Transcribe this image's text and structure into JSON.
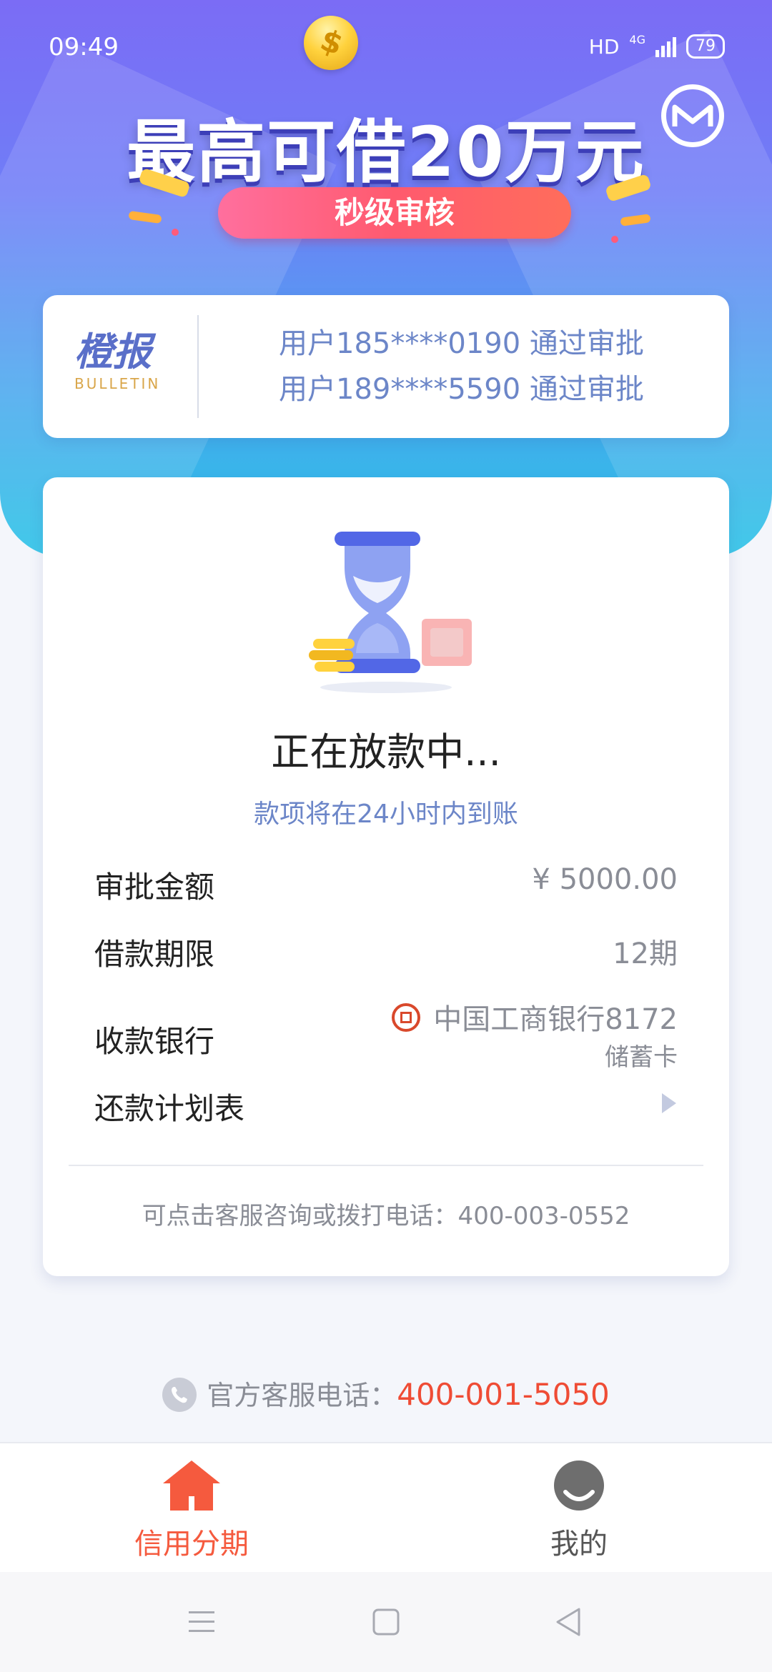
{
  "status_bar": {
    "time": "09:49",
    "hd": "HD",
    "net": "4G",
    "battery": "79"
  },
  "banner": {
    "headline": "最高可借20万元",
    "pill": "秒级审核"
  },
  "bulletin": {
    "logo_cn": "橙报",
    "logo_en": "BULLETIN",
    "messages": [
      "用户185****0190 通过审批",
      "用户189****5590 通过审批"
    ]
  },
  "loan_status": {
    "title": "正在放款中...",
    "subtitle": "款项将在24小时内到账",
    "rows": {
      "amount": {
        "label": "审批金额",
        "value": "¥ 5000.00"
      },
      "term": {
        "label": "借款期限",
        "value": "12期"
      },
      "bank": {
        "label": "收款银行",
        "value": "中国工商银行8172",
        "card_type": "储蓄卡"
      },
      "schedule": {
        "label": "还款计划表"
      }
    },
    "service_note": "可点击客服咨询或拨打电话：400-003-0552"
  },
  "hotline": {
    "label": "官方客服电话：",
    "number": "400-001-5050"
  },
  "tabs": [
    {
      "label": "信用分期",
      "active": true
    },
    {
      "label": "我的",
      "active": false
    }
  ],
  "colors": {
    "accent": "#ef4c35",
    "link_blue": "#6c86c8",
    "gradient_top": "#7b6cf5",
    "gradient_bottom": "#27c2e6"
  }
}
